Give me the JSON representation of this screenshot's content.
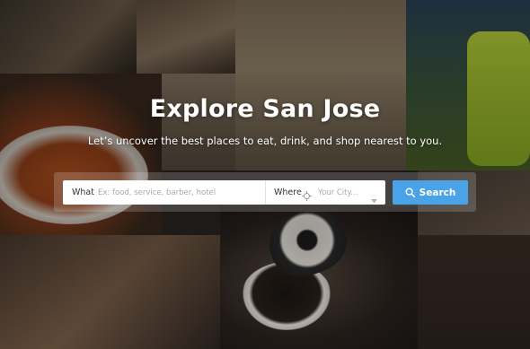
{
  "hero": {
    "title": "Explore San Jose",
    "subtitle": "Let’s uncover the best places to eat, drink, and shop nearest to you."
  },
  "search": {
    "what_label": "What",
    "what_placeholder": "Ex: food, service, barber, hotel",
    "what_value": "",
    "where_label": "Where",
    "where_placeholder": "Your City...",
    "where_value": "",
    "button_label": "Search"
  },
  "icons": {
    "where": "crosshair-icon",
    "dropdown": "chevron-down-icon",
    "search": "search-icon"
  },
  "colors": {
    "search_button": "#4aa3e6",
    "title_text": "#ffffff"
  }
}
